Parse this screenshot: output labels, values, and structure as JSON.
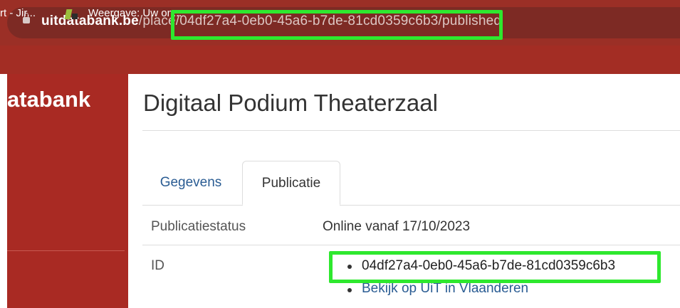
{
  "browser": {
    "url_domain": "uitdatabank.be",
    "url_path": "/place/04df27a4-0eb0-45a6-b7de-81cd0359c6b3/published",
    "bookmarks": [
      {
        "label": "rt - Jir..."
      },
      {
        "label": "Weergave: Uw on..."
      }
    ]
  },
  "sidebar": {
    "brand": "atabank"
  },
  "page": {
    "title": "Digitaal Podium Theaterzaal",
    "tabs": [
      {
        "label": "Gegevens",
        "active": false
      },
      {
        "label": "Publicatie",
        "active": true
      }
    ],
    "rows": {
      "status_label": "Publicatiestatus",
      "status_value": "Online vanaf 17/10/2023",
      "id_label": "ID",
      "id_value": "04df27a4-0eb0-45a6-b7de-81cd0359c6b3",
      "link_label": "Bekijk op UiT in Vlaanderen"
    }
  },
  "colors": {
    "brand_red": "#a92a23",
    "highlight": "#2ee82e",
    "link": "#2a5c93"
  }
}
